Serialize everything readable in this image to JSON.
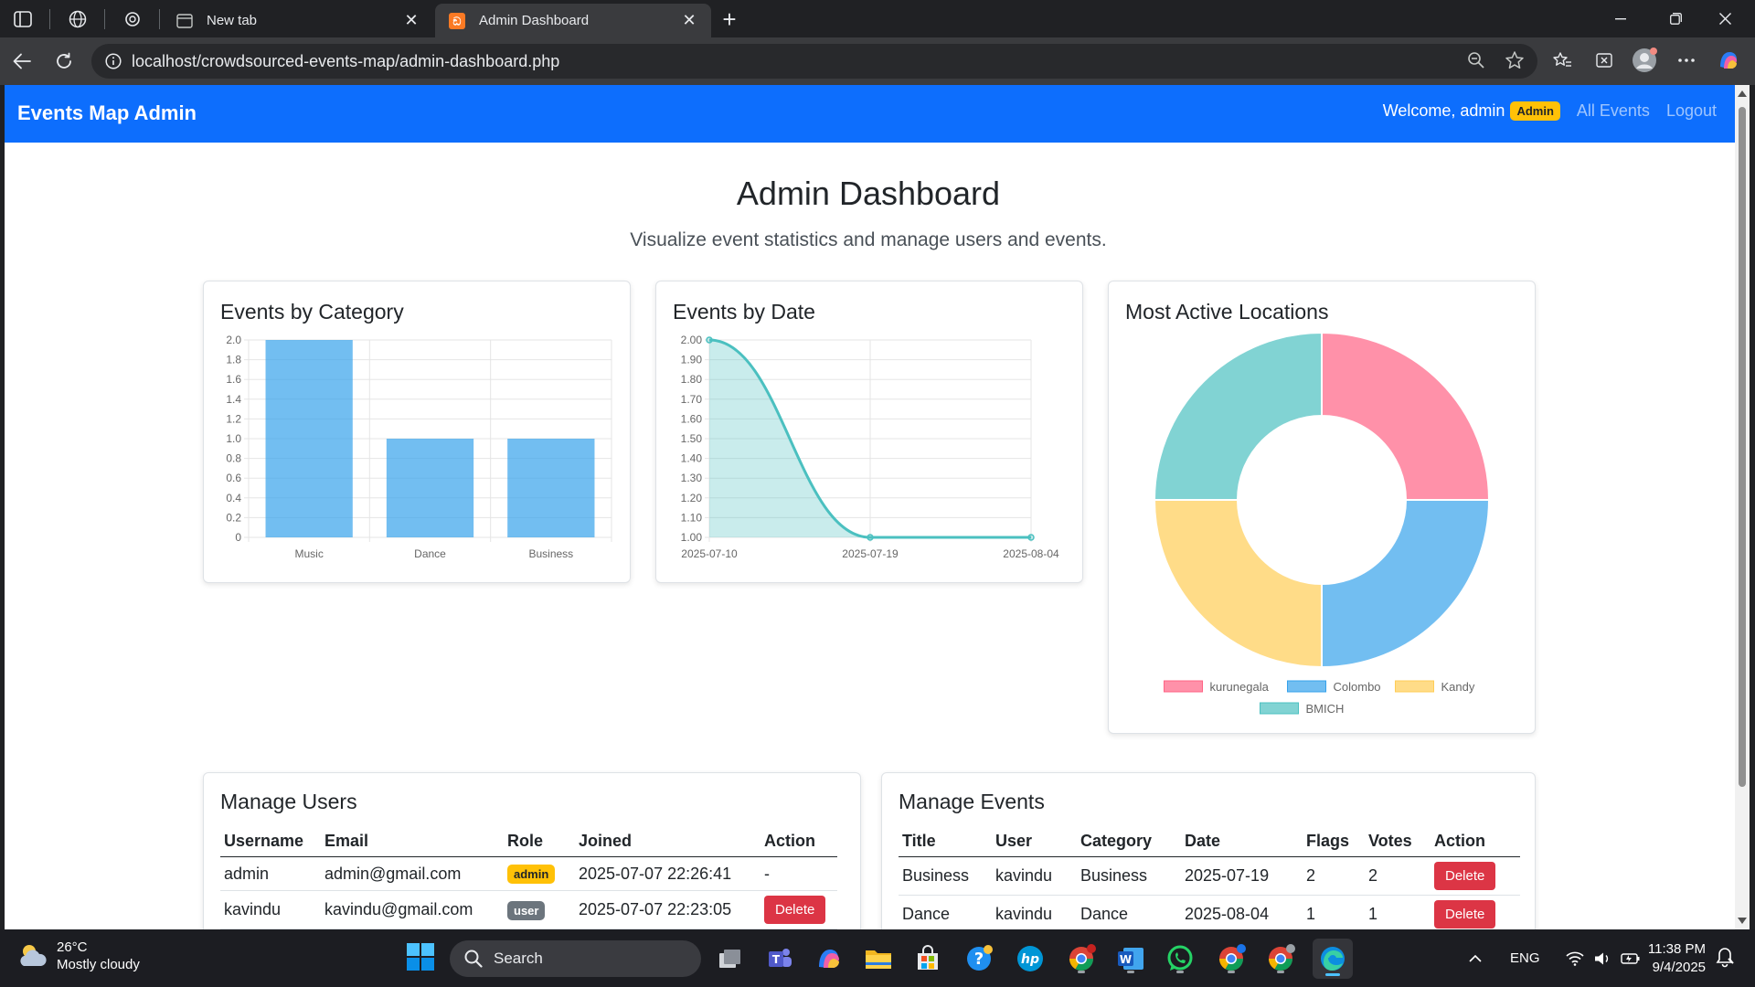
{
  "browser": {
    "tabs": [
      {
        "title": "New tab",
        "active": false
      },
      {
        "title": "Admin Dashboard",
        "active": true
      }
    ],
    "url": "localhost/crowdsourced-events-map/admin-dashboard.php"
  },
  "navbar": {
    "brand": "Events Map Admin",
    "welcome": "Welcome, admin",
    "role_badge": "Admin",
    "links": [
      "All Events",
      "Logout"
    ]
  },
  "header": {
    "title": "Admin Dashboard",
    "subtitle": "Visualize event statistics and manage users and events."
  },
  "chart_data": [
    {
      "type": "bar",
      "title": "Events by Category",
      "categories": [
        "Music",
        "Dance",
        "Business"
      ],
      "values": [
        2,
        1,
        1
      ],
      "ylim": [
        0,
        2.0
      ],
      "yticks": [
        "0",
        "0.2",
        "0.4",
        "0.6",
        "0.8",
        "1.0",
        "1.2",
        "1.4",
        "1.6",
        "1.8",
        "2.0"
      ],
      "color": "#36a2eb",
      "grid": true
    },
    {
      "type": "area",
      "title": "Events by Date",
      "x": [
        "2025-07-10",
        "2025-07-19",
        "2025-08-04"
      ],
      "values": [
        2,
        1,
        1
      ],
      "ylim": [
        1.0,
        2.0
      ],
      "yticks": [
        "1.00",
        "1.10",
        "1.20",
        "1.30",
        "1.40",
        "1.50",
        "1.60",
        "1.70",
        "1.80",
        "1.90",
        "2.00"
      ],
      "color": "#4bc0c0",
      "grid": true
    },
    {
      "type": "pie",
      "title": "Most Active Locations",
      "labels": [
        "kurunegala",
        "Colombo",
        "Kandy",
        "BMICH"
      ],
      "values": [
        1,
        1,
        1,
        1
      ],
      "colors": [
        "#ff6384",
        "#36a2eb",
        "#ffcd56",
        "#4bc0c0"
      ],
      "legend": "bottom"
    }
  ],
  "users": {
    "title": "Manage Users",
    "columns": [
      "Username",
      "Email",
      "Role",
      "Joined",
      "Action"
    ],
    "rows": [
      {
        "username": "admin",
        "email": "admin@gmail.com",
        "role": "admin",
        "joined": "2025-07-07 22:26:41",
        "action": "-"
      },
      {
        "username": "kavindu",
        "email": "kavindu@gmail.com",
        "role": "user",
        "joined": "2025-07-07 22:23:05",
        "action": "Delete"
      }
    ]
  },
  "events": {
    "title": "Manage Events",
    "columns": [
      "Title",
      "User",
      "Category",
      "Date",
      "Flags",
      "Votes",
      "Action"
    ],
    "rows": [
      {
        "title": "Business",
        "user": "kavindu",
        "category": "Business",
        "date": "2025-07-19",
        "flags": "2",
        "votes": "2",
        "action": "Delete"
      },
      {
        "title": "Dance",
        "user": "kavindu",
        "category": "Dance",
        "date": "2025-08-04",
        "flags": "1",
        "votes": "1",
        "action": "Delete"
      }
    ]
  },
  "taskbar": {
    "weather_temp": "26°C",
    "weather_desc": "Mostly cloudy",
    "search": "Search",
    "language": "ENG",
    "time": "11:38 PM",
    "date": "9/4/2025"
  }
}
